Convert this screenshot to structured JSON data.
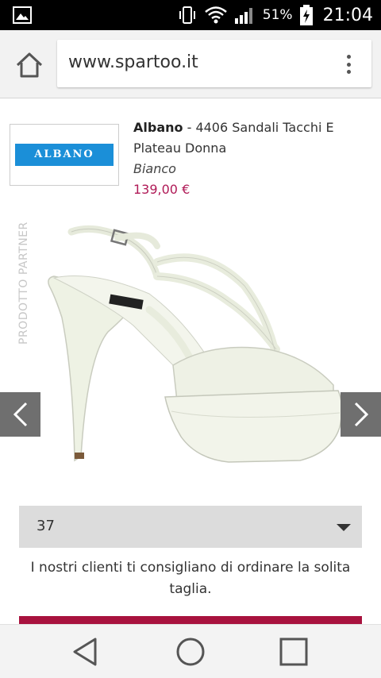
{
  "status_bar": {
    "battery_percent": "51%",
    "time": "21:04",
    "icons": [
      "image-notification-icon",
      "vibrate-icon",
      "wifi-icon",
      "signal-icon",
      "battery-charging-icon"
    ]
  },
  "browser": {
    "url": "www.spartoo.it",
    "icons": [
      "home-icon",
      "overflow-menu-icon"
    ]
  },
  "product": {
    "brand_logo_text": "ALBANO",
    "brand": "Albano",
    "title_rest": " - 4406 Sandali Tacchi E Plateau Donna",
    "color": "Bianco",
    "price": "139,00 €",
    "partner_label": "PRODOTTO PARTNER"
  },
  "carousel": {
    "prev_icon": "chevron-left-icon",
    "next_icon": "chevron-right-icon"
  },
  "size_select": {
    "selected": "37"
  },
  "size_hint": "I nostri clienti ti consigliano di ordinare la solita taglia.",
  "colors": {
    "price": "#b01a57",
    "cta": "#a8123e",
    "logo_blue": "#1b8fd8",
    "arrow_bg": "#6f6f6f"
  },
  "nav_bar": {
    "icons": [
      "back-icon",
      "home-circle-icon",
      "recents-icon"
    ]
  }
}
